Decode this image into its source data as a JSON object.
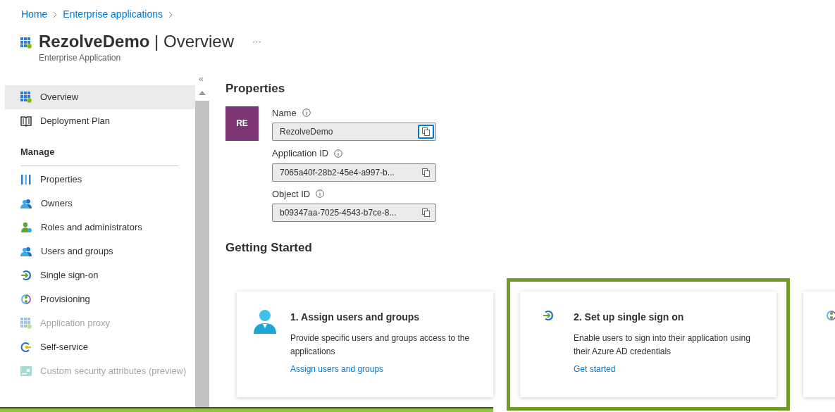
{
  "breadcrumb": [
    "Home",
    "Enterprise applications"
  ],
  "header": {
    "app_name": "RezolveDemo",
    "separator": "|",
    "page": "Overview",
    "subtitle": "Enterprise Application",
    "more": "···"
  },
  "sidebar": {
    "collapse": "«",
    "top_items": [
      {
        "label": "Overview",
        "selected": true,
        "disabled": false
      },
      {
        "label": "Deployment Plan",
        "selected": false,
        "disabled": false
      }
    ],
    "section": "Manage",
    "items": [
      {
        "label": "Properties",
        "selected": false,
        "disabled": false
      },
      {
        "label": "Owners",
        "selected": false,
        "disabled": false
      },
      {
        "label": "Roles and administrators",
        "selected": false,
        "disabled": false
      },
      {
        "label": "Users and groups",
        "selected": false,
        "disabled": false
      },
      {
        "label": "Single sign-on",
        "selected": false,
        "disabled": false
      },
      {
        "label": "Provisioning",
        "selected": false,
        "disabled": false
      },
      {
        "label": "Application proxy",
        "selected": false,
        "disabled": true
      },
      {
        "label": "Self-service",
        "selected": false,
        "disabled": false
      },
      {
        "label": "Custom security attributes (preview)",
        "selected": false,
        "disabled": true
      }
    ]
  },
  "properties": {
    "title": "Properties",
    "avatar": "RE",
    "fields": [
      {
        "label": "Name",
        "value": "RezolveDemo",
        "focused": true
      },
      {
        "label": "Application ID",
        "value": "7065a40f-28b2-45e4-a997-b...",
        "focused": false
      },
      {
        "label": "Object ID",
        "value": "b09347aa-7025-4543-b7ce-8...",
        "focused": false
      }
    ]
  },
  "getting_started": {
    "title": "Getting Started",
    "cards": [
      {
        "title": "1. Assign users and groups",
        "description": "Provide specific users and groups access to the applications",
        "link": "Assign users and groups",
        "highlighted": false
      },
      {
        "title": "2. Set up single sign on",
        "description": "Enable users to sign into their application using their Azure AD credentials",
        "link": "Get started",
        "highlighted": true
      },
      {
        "highlighted": false
      }
    ]
  }
}
